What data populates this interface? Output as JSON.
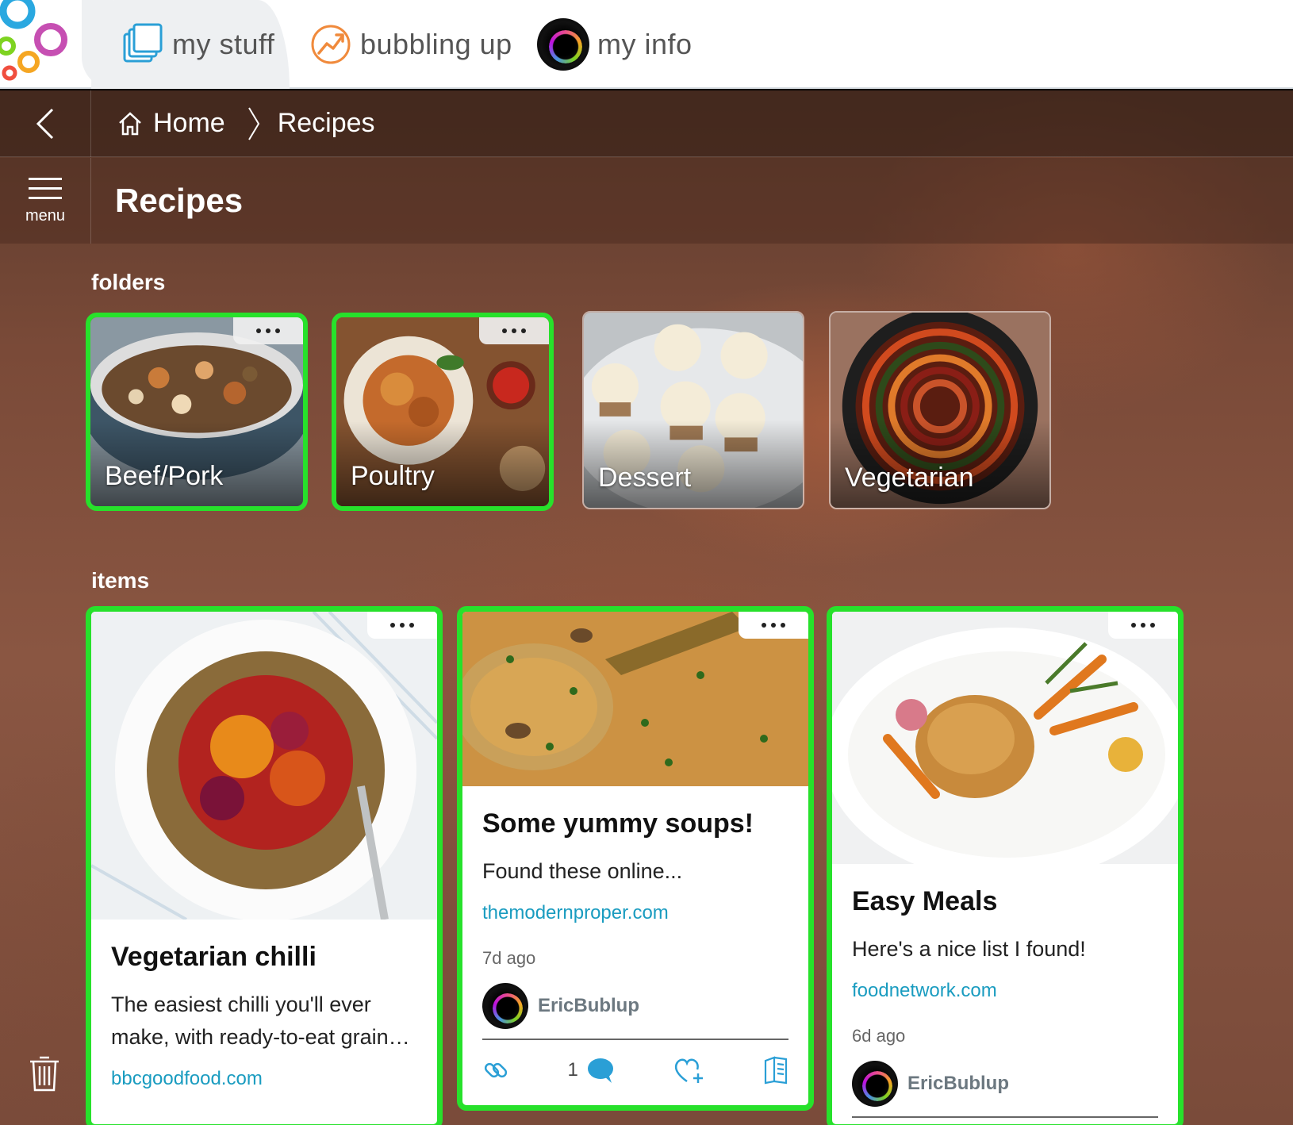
{
  "tabs": [
    {
      "label": "my stuff",
      "icon": "stack-icon",
      "active": true
    },
    {
      "label": "bubbling up",
      "icon": "trending-icon",
      "active": false
    },
    {
      "label": "my info",
      "icon": "avatar",
      "active": false
    }
  ],
  "breadcrumb": {
    "home": "Home",
    "current": "Recipes"
  },
  "menu_label": "menu",
  "page_title": "Recipes",
  "folders_label": "folders",
  "items_label": "items",
  "folders": [
    {
      "name": "Beef/Pork",
      "selected": true
    },
    {
      "name": "Poultry",
      "selected": true
    },
    {
      "name": "Dessert",
      "selected": false
    },
    {
      "name": "Vegetarian",
      "selected": false
    }
  ],
  "items": [
    {
      "title": "Vegetarian chilli",
      "desc": "The easiest chilli you'll ever make, with ready-to-eat grain…",
      "link": "bbcgoodfood.com"
    },
    {
      "title": "Some yummy soups!",
      "desc": "Found these online...",
      "link": "themodernproper.com",
      "time": "7d ago",
      "author": "EricBublup",
      "comments": "1"
    },
    {
      "title": "Easy Meals",
      "desc": "Here's a nice list I found!",
      "link": "foodnetwork.com",
      "time": "6d ago",
      "author": "EricBublup"
    }
  ],
  "colors": {
    "selection": "#27e12b",
    "link": "#1a9cc0",
    "accent_orange": "#f08a3c"
  }
}
